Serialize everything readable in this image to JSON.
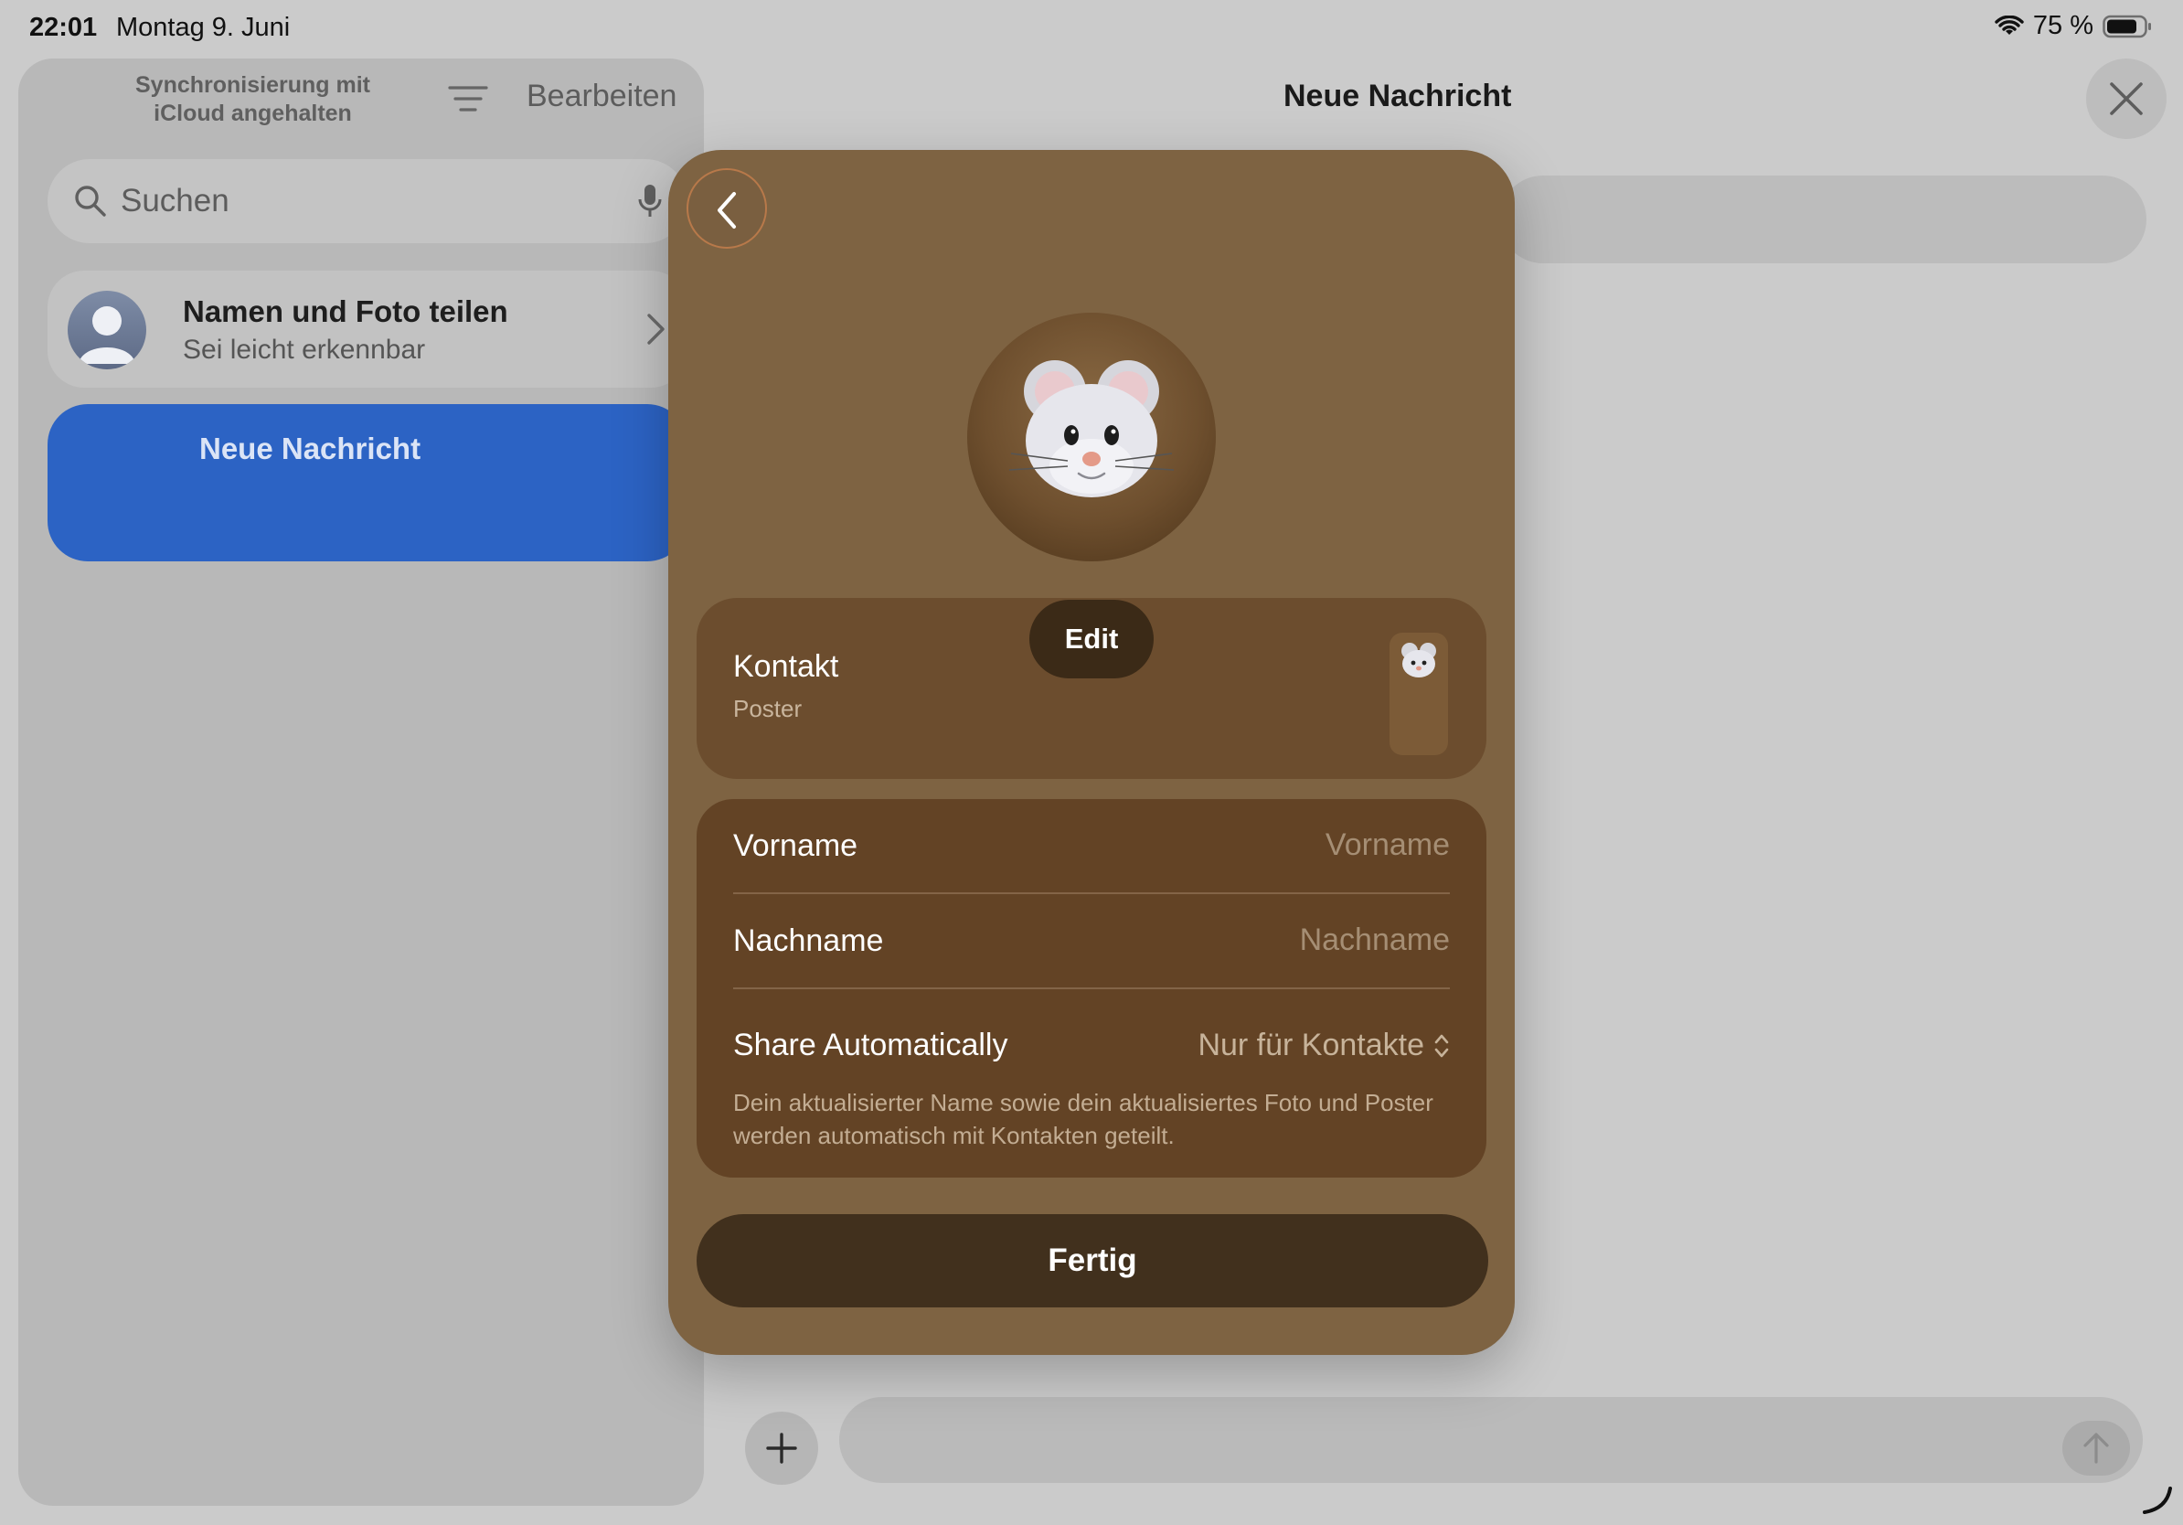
{
  "status_bar": {
    "time": "22:01",
    "date": "Montag 9. Juni",
    "battery": "75 %"
  },
  "sidebar": {
    "sync_status": "Synchronisierung mit iCloud angehalten",
    "edit_label": "Bearbeiten",
    "search": {
      "placeholder": "Suchen"
    },
    "share_card": {
      "title": "Namen und Foto teilen",
      "subtitle": "Sei leicht erkennbar"
    },
    "conversations": [
      {
        "label": "Neue Nachricht",
        "selected": true
      }
    ]
  },
  "main": {
    "title": "Neue Nachricht"
  },
  "modal": {
    "edit_label": "Edit",
    "poster": {
      "title": "Kontakt",
      "subtitle": "Poster"
    },
    "form": {
      "first_name": {
        "label": "Vorname",
        "placeholder": "Vorname",
        "value": ""
      },
      "last_name": {
        "label": "Nachname",
        "placeholder": "Nachname",
        "value": ""
      },
      "share_auto": {
        "label": "Share Automatically",
        "value": "Nur für Kontakte"
      },
      "note": "Dein aktualisierter Name sowie dein aktualisiertes Foto und Poster werden automatisch mit Kontakten geteilt."
    },
    "done_label": "Fertig"
  },
  "colors": {
    "accent_blue": "#2c63c4",
    "modal_brown": "#7e6342",
    "card_brown": "#634325",
    "button_dark": "#41301d"
  },
  "icons": [
    "wifi-icon",
    "battery-icon",
    "filter-icon",
    "search-icon",
    "mic-icon",
    "chevron-right-icon",
    "back-chevron-icon",
    "close-icon",
    "plus-icon",
    "send-arrow-icon",
    "up-down-chevron-icon"
  ]
}
